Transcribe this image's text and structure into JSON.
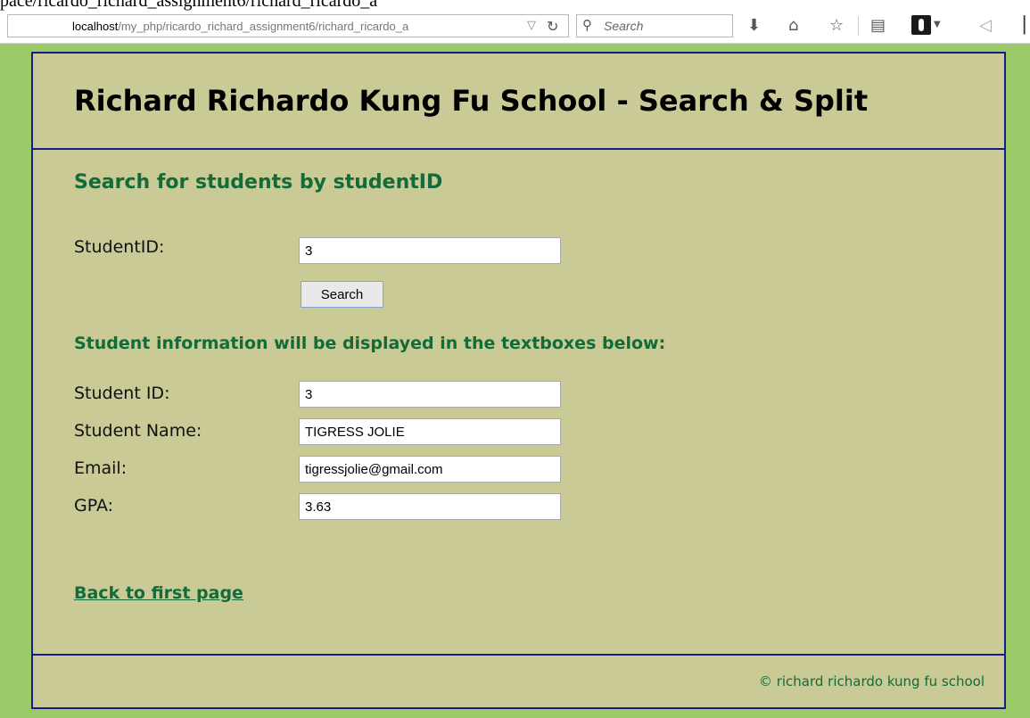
{
  "browser": {
    "cut_text": "pace/ricardo_richard_assignment6/richard_ricardo_a",
    "url_host": "localhost",
    "url_path": "/my_php/ricardo_richard_assignment6/richard_ricardo_a",
    "search_placeholder": "Search",
    "icons": [
      "download-icon",
      "home-icon",
      "star-icon",
      "reader-icon",
      "extension-icon",
      "send-icon"
    ]
  },
  "header": {
    "title": "Richard Richardo Kung Fu School - Search & Split"
  },
  "search_section": {
    "title": "Search for students by studentID",
    "label": "StudentID:",
    "value": "3",
    "button_label": "Search"
  },
  "info_section": {
    "title": "Student information will be displayed in the textboxes below:",
    "fields": [
      {
        "label": "Student ID:",
        "value": "3"
      },
      {
        "label": "Student Name:",
        "value": "TIGRESS JOLIE"
      },
      {
        "label": "Email:",
        "value": "tigressjolie@gmail.com"
      },
      {
        "label": "GPA:",
        "value": "3.63"
      }
    ]
  },
  "back_link": "Back to first page",
  "footer": {
    "copyright": "© richard richardo kung fu school"
  },
  "colors": {
    "page_bg": "#9acb68",
    "content_bg": "#c9ca95",
    "border": "#1a1a8a",
    "heading": "#136b3a"
  }
}
